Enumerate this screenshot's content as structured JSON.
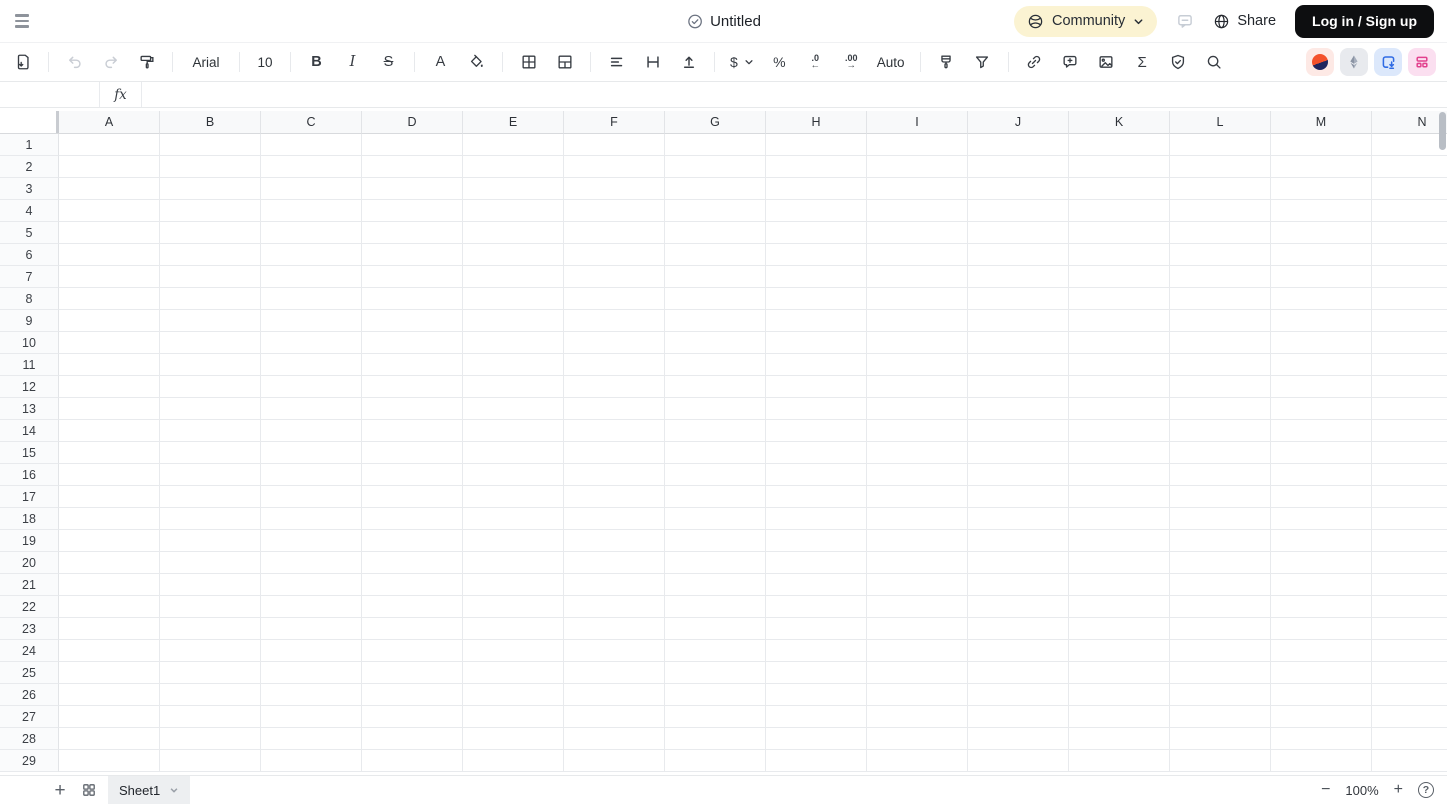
{
  "topbar": {
    "title": "Untitled",
    "community_label": "Community",
    "share_label": "Share",
    "login_label": "Log in / Sign up"
  },
  "toolbar": {
    "font_family": "Arial",
    "font_size": "10",
    "bold_label": "B",
    "italic_label": "I",
    "strikethrough_label": "S",
    "text_color_label": "A",
    "currency_label": "$",
    "percent_label": "%",
    "decrease_decimal_label": ".0",
    "decrease_decimal_arrow": "←",
    "increase_decimal_label": ".00",
    "increase_decimal_arrow": "→",
    "number_format_label": "Auto",
    "sum_label": "Σ"
  },
  "formula_bar": {
    "fx_label": "fx",
    "name_box_value": "",
    "formula_value": ""
  },
  "grid": {
    "columns": [
      "A",
      "B",
      "C",
      "D",
      "E",
      "F",
      "G",
      "H",
      "I",
      "J",
      "K",
      "L",
      "M",
      "N"
    ],
    "row_count": 29
  },
  "bottombar": {
    "add_sheet_label": "+",
    "sheet_tab_label": "Sheet1",
    "zoom_out_label": "−",
    "zoom_level": "100%",
    "zoom_in_label": "+",
    "help_label": "?"
  },
  "colors": {
    "login_button_bg": "#0d0e10",
    "community_pill_bg": "#fbf3d2",
    "plugin_sunset_orange": "#f4512b",
    "plugin_sunset_navy": "#20265f",
    "plugin_eth_gray": "#97a0b0",
    "plugin_import_blue": "#2f6be4",
    "plugin_layout_pink": "#e2418e",
    "grid_line": "#e8eaed",
    "header_bg": "#f8f9fa"
  }
}
